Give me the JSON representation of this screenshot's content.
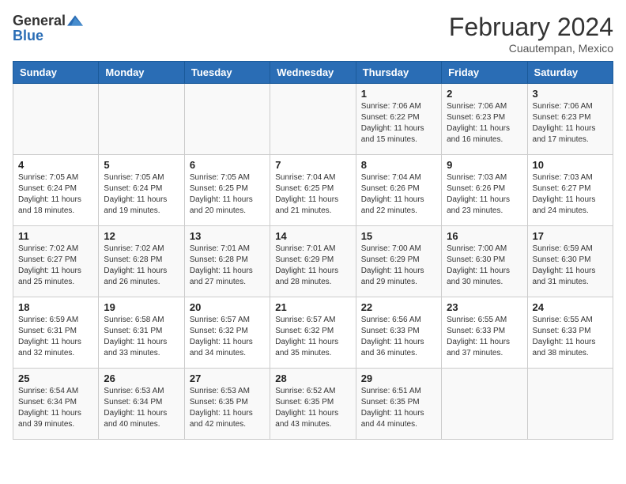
{
  "header": {
    "logo_general": "General",
    "logo_blue": "Blue",
    "title": "February 2024",
    "subtitle": "Cuautempan, Mexico"
  },
  "weekdays": [
    "Sunday",
    "Monday",
    "Tuesday",
    "Wednesday",
    "Thursday",
    "Friday",
    "Saturday"
  ],
  "weeks": [
    [
      {
        "num": "",
        "info": ""
      },
      {
        "num": "",
        "info": ""
      },
      {
        "num": "",
        "info": ""
      },
      {
        "num": "",
        "info": ""
      },
      {
        "num": "1",
        "info": "Sunrise: 7:06 AM\nSunset: 6:22 PM\nDaylight: 11 hours and 15 minutes."
      },
      {
        "num": "2",
        "info": "Sunrise: 7:06 AM\nSunset: 6:23 PM\nDaylight: 11 hours and 16 minutes."
      },
      {
        "num": "3",
        "info": "Sunrise: 7:06 AM\nSunset: 6:23 PM\nDaylight: 11 hours and 17 minutes."
      }
    ],
    [
      {
        "num": "4",
        "info": "Sunrise: 7:05 AM\nSunset: 6:24 PM\nDaylight: 11 hours and 18 minutes."
      },
      {
        "num": "5",
        "info": "Sunrise: 7:05 AM\nSunset: 6:24 PM\nDaylight: 11 hours and 19 minutes."
      },
      {
        "num": "6",
        "info": "Sunrise: 7:05 AM\nSunset: 6:25 PM\nDaylight: 11 hours and 20 minutes."
      },
      {
        "num": "7",
        "info": "Sunrise: 7:04 AM\nSunset: 6:25 PM\nDaylight: 11 hours and 21 minutes."
      },
      {
        "num": "8",
        "info": "Sunrise: 7:04 AM\nSunset: 6:26 PM\nDaylight: 11 hours and 22 minutes."
      },
      {
        "num": "9",
        "info": "Sunrise: 7:03 AM\nSunset: 6:26 PM\nDaylight: 11 hours and 23 minutes."
      },
      {
        "num": "10",
        "info": "Sunrise: 7:03 AM\nSunset: 6:27 PM\nDaylight: 11 hours and 24 minutes."
      }
    ],
    [
      {
        "num": "11",
        "info": "Sunrise: 7:02 AM\nSunset: 6:27 PM\nDaylight: 11 hours and 25 minutes."
      },
      {
        "num": "12",
        "info": "Sunrise: 7:02 AM\nSunset: 6:28 PM\nDaylight: 11 hours and 26 minutes."
      },
      {
        "num": "13",
        "info": "Sunrise: 7:01 AM\nSunset: 6:28 PM\nDaylight: 11 hours and 27 minutes."
      },
      {
        "num": "14",
        "info": "Sunrise: 7:01 AM\nSunset: 6:29 PM\nDaylight: 11 hours and 28 minutes."
      },
      {
        "num": "15",
        "info": "Sunrise: 7:00 AM\nSunset: 6:29 PM\nDaylight: 11 hours and 29 minutes."
      },
      {
        "num": "16",
        "info": "Sunrise: 7:00 AM\nSunset: 6:30 PM\nDaylight: 11 hours and 30 minutes."
      },
      {
        "num": "17",
        "info": "Sunrise: 6:59 AM\nSunset: 6:30 PM\nDaylight: 11 hours and 31 minutes."
      }
    ],
    [
      {
        "num": "18",
        "info": "Sunrise: 6:59 AM\nSunset: 6:31 PM\nDaylight: 11 hours and 32 minutes."
      },
      {
        "num": "19",
        "info": "Sunrise: 6:58 AM\nSunset: 6:31 PM\nDaylight: 11 hours and 33 minutes."
      },
      {
        "num": "20",
        "info": "Sunrise: 6:57 AM\nSunset: 6:32 PM\nDaylight: 11 hours and 34 minutes."
      },
      {
        "num": "21",
        "info": "Sunrise: 6:57 AM\nSunset: 6:32 PM\nDaylight: 11 hours and 35 minutes."
      },
      {
        "num": "22",
        "info": "Sunrise: 6:56 AM\nSunset: 6:33 PM\nDaylight: 11 hours and 36 minutes."
      },
      {
        "num": "23",
        "info": "Sunrise: 6:55 AM\nSunset: 6:33 PM\nDaylight: 11 hours and 37 minutes."
      },
      {
        "num": "24",
        "info": "Sunrise: 6:55 AM\nSunset: 6:33 PM\nDaylight: 11 hours and 38 minutes."
      }
    ],
    [
      {
        "num": "25",
        "info": "Sunrise: 6:54 AM\nSunset: 6:34 PM\nDaylight: 11 hours and 39 minutes."
      },
      {
        "num": "26",
        "info": "Sunrise: 6:53 AM\nSunset: 6:34 PM\nDaylight: 11 hours and 40 minutes."
      },
      {
        "num": "27",
        "info": "Sunrise: 6:53 AM\nSunset: 6:35 PM\nDaylight: 11 hours and 42 minutes."
      },
      {
        "num": "28",
        "info": "Sunrise: 6:52 AM\nSunset: 6:35 PM\nDaylight: 11 hours and 43 minutes."
      },
      {
        "num": "29",
        "info": "Sunrise: 6:51 AM\nSunset: 6:35 PM\nDaylight: 11 hours and 44 minutes."
      },
      {
        "num": "",
        "info": ""
      },
      {
        "num": "",
        "info": ""
      }
    ]
  ]
}
